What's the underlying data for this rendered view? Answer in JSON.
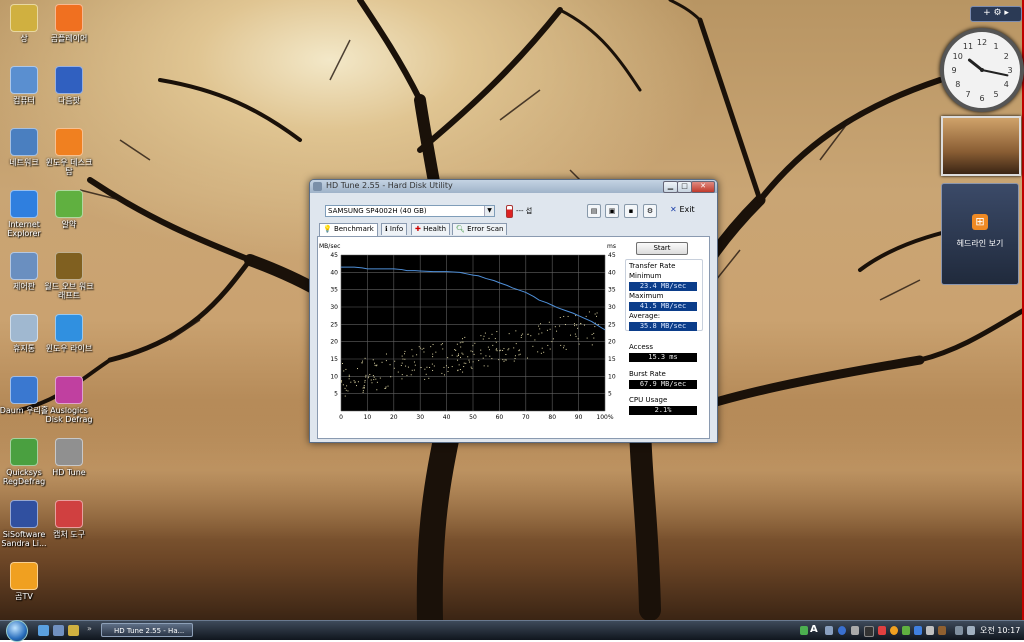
{
  "desktop": {
    "icons_left": [
      {
        "label": "상",
        "color": "#d0b040"
      },
      {
        "label": "컴퓨터",
        "color": "#5a8fd0"
      },
      {
        "label": "네트워크",
        "color": "#4a7fc0"
      },
      {
        "label": "Internet Explorer",
        "color": "#2f7fdf"
      },
      {
        "label": "제어판",
        "color": "#6a8fc0"
      },
      {
        "label": "휴지통",
        "color": "#a0b8d0"
      },
      {
        "label": "Daum 우리홀",
        "color": "#3a78d0"
      },
      {
        "label": "Quicksys RegDefrag",
        "color": "#4aa040"
      },
      {
        "label": "SiSoftware Sandra Li...",
        "color": "#3050a0"
      },
      {
        "label": "곰TV",
        "color": "#f0a020"
      }
    ],
    "icons_right": [
      {
        "label": "곰플레이어",
        "color": "#f07020"
      },
      {
        "label": "다음팟",
        "color": "#3060c0"
      },
      {
        "label": "윈도우 데스크탑",
        "color": "#f08020"
      },
      {
        "label": "알약",
        "color": "#60b040"
      },
      {
        "label": "월드 오브 워크래프트",
        "color": "#806020"
      },
      {
        "label": "윈도우 라이브",
        "color": "#3090e0"
      },
      {
        "label": "Auslogics Disk Defrag",
        "color": "#c040a0"
      },
      {
        "label": "HD Tune",
        "color": "#909090"
      },
      {
        "label": "캡처 도구",
        "color": "#d04040"
      }
    ]
  },
  "gadgets": {
    "toolbar_label": "+ ⚙ ▸",
    "feed_label": "헤드라인 보기",
    "feed_icon": "rss-icon",
    "clock": {
      "hour": 10,
      "minute": 17
    }
  },
  "window": {
    "title": "HD Tune 2.55 - Hard Disk Utility",
    "drive": "SAMSUNG SP4002H (40 GB)",
    "temperature": "--- 섭",
    "exit_label": "Exit",
    "tabs": [
      "Benchmark",
      "Info",
      "Health",
      "Error Scan"
    ],
    "start_button": "Start",
    "transfer_rate_label": "Transfer Rate",
    "minimum_label": "Minimum",
    "minimum_value": "23.4 MB/sec",
    "maximum_label": "Maximum",
    "maximum_value": "41.5 MB/sec",
    "average_label": "Average:",
    "average_value": "35.8 MB/sec",
    "access_label": "Access",
    "access_value": "15.3 ms",
    "burst_label": "Burst Rate",
    "burst_value": "67.9 MB/sec",
    "cpu_label": "CPU Usage",
    "cpu_value": "2.1%",
    "accent_blue": "#0b3d8a",
    "title_icons": [
      "minimize-icon",
      "maximize-icon",
      "close-icon"
    ]
  },
  "chart_data": {
    "type": "line",
    "xlabel": "",
    "ylabel_left": "MB/sec",
    "ylabel_right": "ms",
    "x_ticks": [
      "0",
      "10",
      "20",
      "30",
      "40",
      "50",
      "60",
      "70",
      "80",
      "90",
      "100%"
    ],
    "y_ticks": [
      "5",
      "10",
      "15",
      "20",
      "25",
      "30",
      "35",
      "40",
      "45"
    ],
    "xlim": [
      0,
      100
    ],
    "ylim": [
      0,
      45
    ],
    "grid": true,
    "series": [
      {
        "x": [
          0,
          5,
          8,
          10,
          15,
          20,
          23,
          25,
          28,
          30,
          35,
          40,
          45,
          48,
          50,
          52,
          55,
          58,
          60,
          63,
          65,
          67,
          70,
          73,
          75,
          78,
          80,
          82,
          85,
          88,
          90,
          92,
          95,
          97,
          100
        ],
        "y": [
          41.5,
          41.5,
          41.3,
          41.0,
          41.0,
          41.0,
          40.8,
          40.5,
          40.5,
          40.4,
          40.2,
          40.2,
          40.0,
          39.5,
          39.2,
          39.0,
          38.2,
          37.6,
          37.0,
          36.2,
          35.5,
          35.0,
          34.2,
          33.0,
          32.0,
          31.2,
          30.5,
          29.8,
          29.0,
          28.2,
          27.5,
          26.8,
          25.8,
          24.8,
          23.4
        ]
      }
    ],
    "access_scatter": {
      "x_range": [
        0,
        100
      ],
      "y_at_start": [
        4,
        14
      ],
      "y_at_end": [
        20,
        30
      ]
    },
    "colors": {
      "line": "#4f8fd8",
      "scatter": "#d8d0a0",
      "grid": "#606060",
      "bg": "#000000"
    }
  },
  "taskbar": {
    "task_label": "HD Tune 2.55 - Ha...",
    "lang": "A",
    "clock": "오전 10:17"
  }
}
